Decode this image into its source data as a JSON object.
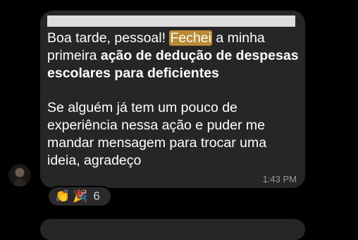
{
  "message": {
    "line1_pre": "Boa tarde, pessoal! ",
    "line1_highlight": "Fechei",
    "line1_post": " a minha",
    "line2_pre": "primeira ",
    "bold_text": "ação de dedução de despesas escolares para deficientes",
    "paragraph2": "Se alguém já tem um pouco de experiência nessa ação e puder me mandar mensagem para trocar uma ideia, agradeço",
    "timestamp": "1:43 PM"
  },
  "reactions": {
    "emojis": [
      "clapping-hands-icon",
      "party-popper-icon"
    ],
    "count": "6"
  },
  "colors": {
    "background": "#000000",
    "bubble": "#262628",
    "highlight": "#b98a36",
    "text": "#ffffff",
    "timestamp": "#9a9a9e"
  }
}
